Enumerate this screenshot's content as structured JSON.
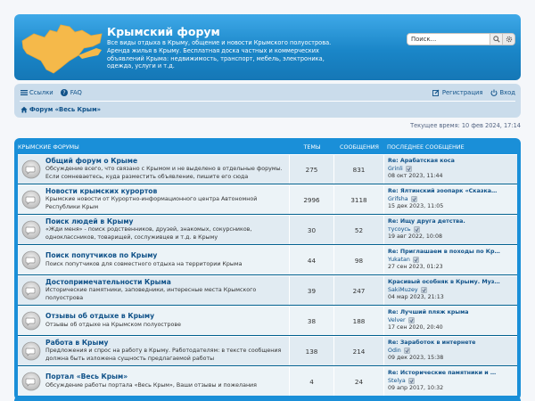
{
  "header": {
    "title": "Крымский форум",
    "description": "Все виды отдыха в Крыму, общение и новости Крымского полуострова. Аренда жилья в Крыму. Бесплатная доска частных и коммерческих объявлений Крыма: недвижимость, транспорт, мебель, электроника, одежда, услуги и т.д.",
    "search_placeholder": "Поиск…"
  },
  "nav": {
    "links_label": "Ссылки",
    "faq_label": "FAQ",
    "register_label": "Регистрация",
    "login_label": "Вход",
    "breadcrumb": "Форум «Весь Крым»"
  },
  "current_time": "Текущее время: 10 фев 2024, 17:14",
  "forum_table": {
    "header_title": "КРЫМСКИЕ ФОРУМЫ",
    "header_topics": "ТЕМЫ",
    "header_posts": "СООБЩЕНИЯ",
    "header_last": "ПОСЛЕДНЕЕ СООБЩЕНИЕ",
    "rows": [
      {
        "title": "Общий форум о Крыме",
        "desc": "Обсуждение всего, что связано с Крымом и не выделено в отдельные форумы. Если сомневаетесь, куда разместить объявление, пишите его сюда",
        "topics": "275",
        "posts": "831",
        "last_title": "Re: Арабатская коса",
        "last_author": "Grinli",
        "last_date": "08 окт 2023, 11:44"
      },
      {
        "title": "Новости крымских курортов",
        "desc": "Крымские новости от Курортно-информационного центра Автономной Республики Крым",
        "topics": "2996",
        "posts": "3118",
        "last_title": "Re: Ялтинский зоопарк «Сказка…",
        "last_author": "Grifsha",
        "last_date": "15 дек 2023, 11:05"
      },
      {
        "title": "Поиск людей в Крыму",
        "desc": "«Жди меня» - поиск родственников, друзей, знакомых, сокурсников, одноклассников, товарищей, сослуживцев и т.д. в Крыму",
        "topics": "30",
        "posts": "52",
        "last_title": "Re: Ищу друга детства.",
        "last_author": "тусоусь",
        "last_date": "19 авг 2022, 10:08"
      },
      {
        "title": "Поиск попутчиков по Крыму",
        "desc": "Поиск попутчиков для совместного отдыха на территории Крыма",
        "topics": "44",
        "posts": "98",
        "last_title": "Re: Приглашаем в походы по Кр…",
        "last_author": "Yukatan",
        "last_date": "27 сен 2023, 01:23"
      },
      {
        "title": "Достопримечательности Крыма",
        "desc": "Исторические памятники, заповедники, интересные места Крымского полуострова",
        "topics": "39",
        "posts": "247",
        "last_title": "Красивый особняк в Крыму. Муз…",
        "last_author": "SakiMuzey",
        "last_date": "04 мар 2023, 21:13"
      },
      {
        "title": "Отзывы об отдыхе в Крыму",
        "desc": "Отзывы об отдыхе на Крымском полуострове",
        "topics": "38",
        "posts": "188",
        "last_title": "Re: Лучший пляж крыма",
        "last_author": "Velver",
        "last_date": "17 сен 2020, 20:40"
      },
      {
        "title": "Работа в Крыму",
        "desc": "Предложения и спрос на работу в Крыму. Работодателям: в тексте сообщения должна быть изложена сущность предлагаемой работы",
        "topics": "138",
        "posts": "214",
        "last_title": "Re: Заработок в интернете",
        "last_author": "Odin",
        "last_date": "09 дек 2023, 15:38"
      },
      {
        "title": "Портал «Весь Крым»",
        "desc": "Обсуждение работы портала «Весь Крым», Ваши отзывы и пожелания",
        "topics": "4",
        "posts": "24",
        "last_title": "Re: Исторические памятники и …",
        "last_author": "Stelya",
        "last_date": "09 апр 2017, 10:32"
      }
    ]
  },
  "colors": {
    "header_blue": "#1a86c8",
    "navbar_bg": "#cadceb",
    "link": "#105289",
    "row_light": "#ecf3f7",
    "row_dark": "#e1ebf2"
  }
}
